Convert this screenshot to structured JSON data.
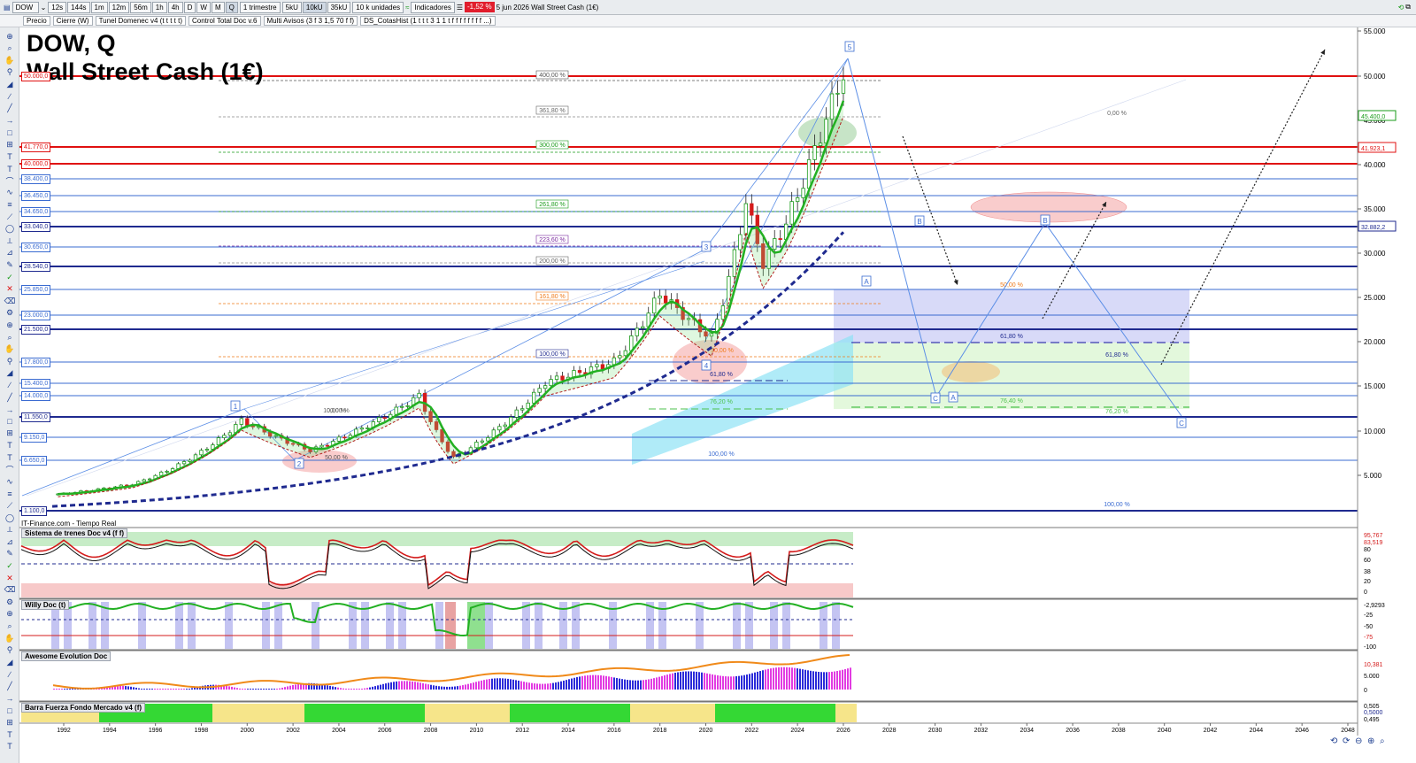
{
  "toolbar": {
    "symbol": "DOW",
    "timeframes": [
      "12s",
      "144s",
      "1m",
      "12m",
      "56m",
      "1h",
      "4h",
      "D",
      "W",
      "M",
      "Q"
    ],
    "period_select": "1 trimestre",
    "tick_buttons": [
      "5kU",
      "10kU",
      "35kU"
    ],
    "units_select": "10 k unidades",
    "indicators_label": "Indicadores",
    "change_pct": "-1,52 %",
    "date_text": "5 jun 2026 Wall Street Cash (1€)"
  },
  "overlays": [
    "Precio",
    "Cierre (W)",
    "Tunel Domenec v4 (t t t t t)",
    "Control Total Doc v.6",
    "Multi Avisos (3 f 3 1,5 70 f f)",
    "DS_CotasHist (1 t t t 3 1 1 t f f f f f f f f ...)"
  ],
  "chart": {
    "title_line1": "DOW, Q",
    "title_line2": "Wall Street Cash (1€)",
    "source": "IT-Finance.com - Tiempo Real",
    "colors": {
      "up": "#1a9b1a",
      "down": "#d41b1b",
      "tunnel": "#22b022",
      "trend": "#1f2a8f",
      "support": "#1f2a8f",
      "resistance": "#e01010"
    }
  },
  "right_axis": {
    "ticks": [
      "55.000",
      "50.000",
      "45.000",
      "40.000",
      "35.000",
      "30.000",
      "25.000",
      "20.000",
      "15.000",
      "10.000",
      "5.000"
    ],
    "price_tags": [
      "45.400,0",
      "41.923,1",
      "32.882,2"
    ]
  },
  "levels": [
    {
      "label": "50.000,0",
      "color": "#e01010"
    },
    {
      "label": "41.770,0",
      "color": "#e01010"
    },
    {
      "label": "40.000,0",
      "color": "#e01010"
    },
    {
      "label": "38.400,0",
      "color": "#3a6bd1"
    },
    {
      "label": "36.450,0",
      "color": "#3a6bd1"
    },
    {
      "label": "34.650,0",
      "color": "#3a6bd1"
    },
    {
      "label": "33.040,0",
      "color": "#1f2a8f"
    },
    {
      "label": "30.650,0",
      "color": "#3a6bd1"
    },
    {
      "label": "28.540,0",
      "color": "#1f2a8f"
    },
    {
      "label": "25.850,0",
      "color": "#3a6bd1"
    },
    {
      "label": "23.000,0",
      "color": "#3a6bd1"
    },
    {
      "label": "21.500,0",
      "color": "#1f2a8f"
    },
    {
      "label": "17.800,0",
      "color": "#3a6bd1"
    },
    {
      "label": "15.400,0",
      "color": "#3a6bd1"
    },
    {
      "label": "14.000,0",
      "color": "#3a6bd1"
    },
    {
      "label": "11.550,0",
      "color": "#1f2a8f"
    },
    {
      "label": "9.150,0",
      "color": "#3a6bd1"
    },
    {
      "label": "6.650,0",
      "color": "#3a6bd1"
    },
    {
      "label": "1.100,0",
      "color": "#1f2a8f"
    }
  ],
  "fib_labels": [
    "400,00 %",
    "361,80 %",
    "300,00 %",
    "261,80 %",
    "223,60 %",
    "200,00 %",
    "161,80 %",
    "100,00 %",
    "0,00 %",
    "50,00 %",
    "100,00 %",
    "61,80 %",
    "76,20 %",
    "50,00 %",
    "61,80 %",
    "76,40 %",
    "61,80 %",
    "76,20 %",
    "100,00 %",
    "0,00 %",
    "50,00 %",
    "100,00 %"
  ],
  "wave_labels": [
    "1",
    "2",
    "3",
    "4",
    "5",
    "A",
    "B",
    "C",
    "A",
    "B",
    "C"
  ],
  "panels": {
    "trend_system": {
      "title": "Sistema de trenes Doc v4 (f f)",
      "axis": [
        "95,767",
        "83,519",
        "80",
        "60",
        "38",
        "20",
        "0"
      ]
    },
    "willy": {
      "title": "Willy Doc (t)",
      "axis": [
        "-2,9293",
        "-25",
        "-50",
        "-75",
        "-100"
      ]
    },
    "awesome": {
      "title": "Awesome Evolution Doc",
      "axis": [
        "10,381",
        "5.000",
        "0"
      ]
    },
    "strength_bar": {
      "title": "Barra Fuerza Fondo Mercado v4 (f)",
      "axis": [
        "0,505",
        "0,5000",
        "0,495"
      ]
    }
  },
  "x_axis": [
    "1992",
    "1994",
    "1996",
    "1998",
    "2000",
    "2002",
    "2004",
    "2006",
    "2008",
    "2010",
    "2012",
    "2014",
    "2016",
    "2018",
    "2020",
    "2022",
    "2024",
    "2026",
    "2028",
    "2030",
    "2032",
    "2034",
    "2036",
    "2038",
    "2040",
    "2042",
    "2044",
    "2046",
    "2048"
  ]
}
